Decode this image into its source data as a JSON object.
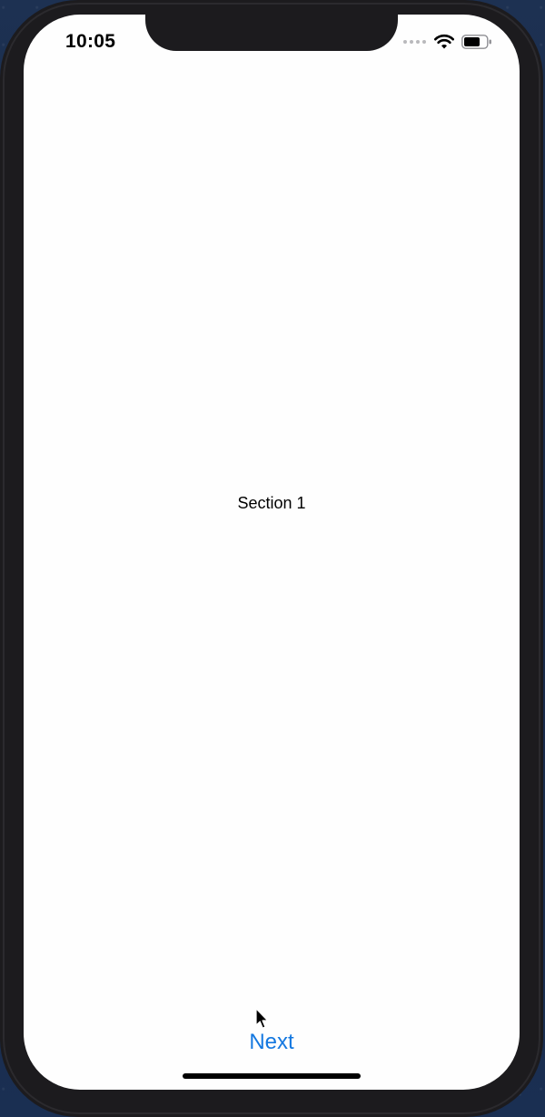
{
  "status_bar": {
    "time": "10:05",
    "signal_icon": "cellular-signal-icon",
    "wifi_icon": "wifi-icon",
    "battery_icon": "battery-icon"
  },
  "content": {
    "section_label": "Section 1"
  },
  "footer": {
    "next_label": "Next"
  },
  "colors": {
    "accent": "#1478e0",
    "screen_background": "#fefefe",
    "device_frame": "#1c1b1e"
  }
}
